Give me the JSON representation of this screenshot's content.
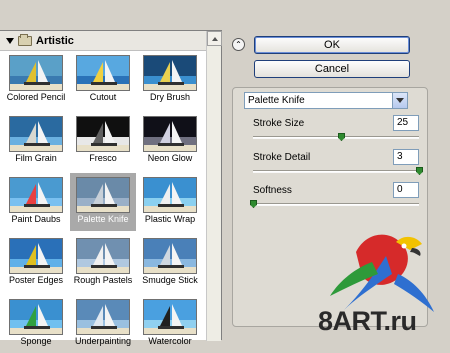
{
  "gallery": {
    "category": "Artistic",
    "thumbnails": [
      {
        "label": "Colored Pencil"
      },
      {
        "label": "Cutout"
      },
      {
        "label": "Dry Brush"
      },
      {
        "label": "Film Grain"
      },
      {
        "label": "Fresco"
      },
      {
        "label": "Neon Glow"
      },
      {
        "label": "Paint Daubs"
      },
      {
        "label": "Palette Knife",
        "selected": true
      },
      {
        "label": "Plastic Wrap"
      },
      {
        "label": "Poster Edges"
      },
      {
        "label": "Rough Pastels"
      },
      {
        "label": "Smudge Stick"
      },
      {
        "label": "Sponge"
      },
      {
        "label": "Underpainting"
      },
      {
        "label": "Watercolor"
      }
    ]
  },
  "buttons": {
    "ok": "OK",
    "cancel": "Cancel"
  },
  "filter": {
    "selected": "Palette Knife"
  },
  "params": [
    {
      "label": "Stroke Size",
      "value": "25",
      "fraction": 0.53
    },
    {
      "label": "Stroke Detail",
      "value": "3",
      "fraction": 1.0
    },
    {
      "label": "Softness",
      "value": "0",
      "fraction": 0.0
    }
  ],
  "watermark": "8ART.ru",
  "colors": {
    "accent_border": "#1f3f7a",
    "slider_thumb": "#2f8a2f",
    "selected_thumb": "#a9a9a9"
  }
}
